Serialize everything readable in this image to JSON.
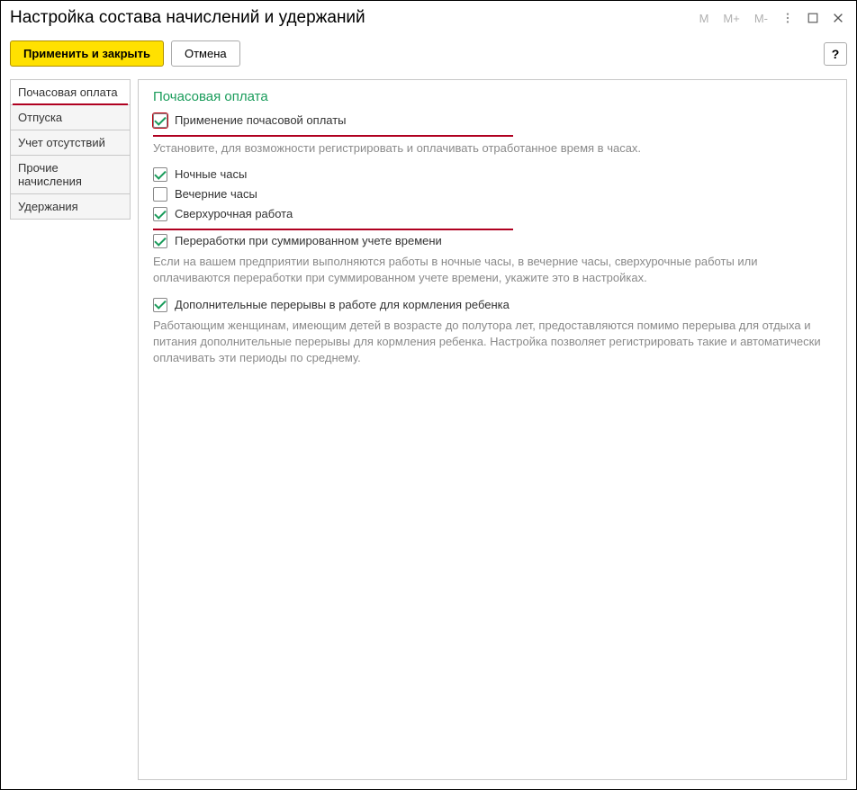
{
  "window": {
    "title": "Настройка состава начислений и удержаний",
    "tb": {
      "m": "М",
      "mplus": "М+",
      "mminus": "М-"
    }
  },
  "toolbar": {
    "apply_close": "Применить и закрыть",
    "cancel": "Отмена",
    "help": "?"
  },
  "sidebar": {
    "items": [
      {
        "label": "Почасовая оплата"
      },
      {
        "label": "Отпуска"
      },
      {
        "label": "Учет отсутствий"
      },
      {
        "label": "Прочие начисления"
      },
      {
        "label": "Удержания"
      }
    ]
  },
  "content": {
    "title": "Почасовая оплата",
    "use_hourly": {
      "label": "Применение почасовой оплаты",
      "hint": "Установите, для возможности регистрировать и оплачивать отработанное время в часах."
    },
    "night": {
      "label": "Ночные часы"
    },
    "evening": {
      "label": "Вечерние часы"
    },
    "overtime": {
      "label": "Сверхурочная работа"
    },
    "summarized": {
      "label": "Переработки при суммированном учете времени",
      "hint": "Если на вашем предприятии выполняются работы в ночные часы, в вечерние часы, сверхурочные работы или оплачиваются переработки при суммированном учете времени, укажите это в настройках."
    },
    "nursing": {
      "label": "Дополнительные перерывы в работе для кормления ребенка",
      "hint": "Работающим женщинам, имеющим детей в возрасте до полутора лет, предоставляются помимо перерыва для отдыха и питания дополнительные перерывы для кормления ребенка. Настройка позволяет регистрировать такие и автоматически оплачивать эти периоды по среднему."
    }
  }
}
